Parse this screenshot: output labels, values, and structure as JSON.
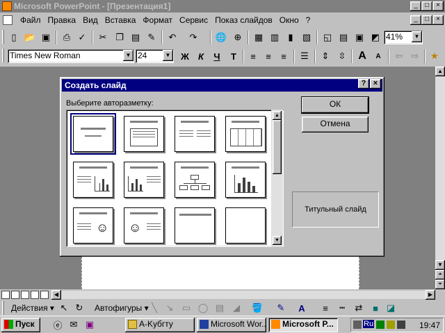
{
  "window": {
    "title": "Microsoft PowerPoint - [Презентация1]",
    "controls": {
      "minimize": "_",
      "maximize": "□",
      "close": "×"
    }
  },
  "menubar": {
    "items": [
      "Файл",
      "Правка",
      "Вид",
      "Вставка",
      "Формат",
      "Сервис",
      "Показ слайдов",
      "Окно",
      "?"
    ]
  },
  "toolbar_standard": {
    "icons": [
      "new-icon",
      "open-icon",
      "save-icon",
      "print-icon",
      "spelling-icon",
      "cut-icon",
      "copy-icon",
      "paste-icon",
      "format-painter-icon",
      "undo-icon",
      "redo-icon",
      "hyperlink-icon",
      "web-icon",
      "insert-table-icon",
      "insert-excel-icon",
      "insert-chart-icon",
      "new-slide-icon",
      "slide-layout-icon",
      "apply-design-icon",
      "grayscale-icon"
    ],
    "zoom": "41%"
  },
  "toolbar_formatting": {
    "font": "Times New Roman",
    "size": "24",
    "bold": "Ж",
    "italic": "К",
    "underline": "Ч",
    "shadow": "Т",
    "increase_font": "A",
    "decrease_font": "A"
  },
  "dialog": {
    "title": "Создать слайд",
    "help": "?",
    "close": "×",
    "prompt": "Выберите авторазметку:",
    "ok": "ОК",
    "cancel": "Отмена",
    "preview_label": "Титульный слайд"
  },
  "drawbar": {
    "actions": "Действия",
    "autoshapes": "Автофигуры"
  },
  "taskbar": {
    "start": "Пуск",
    "tasks": [
      "A-Kyбгту",
      "Microsoft Wor...",
      "Microsoft P..."
    ],
    "clock": "19:47",
    "lang": "Ru"
  }
}
